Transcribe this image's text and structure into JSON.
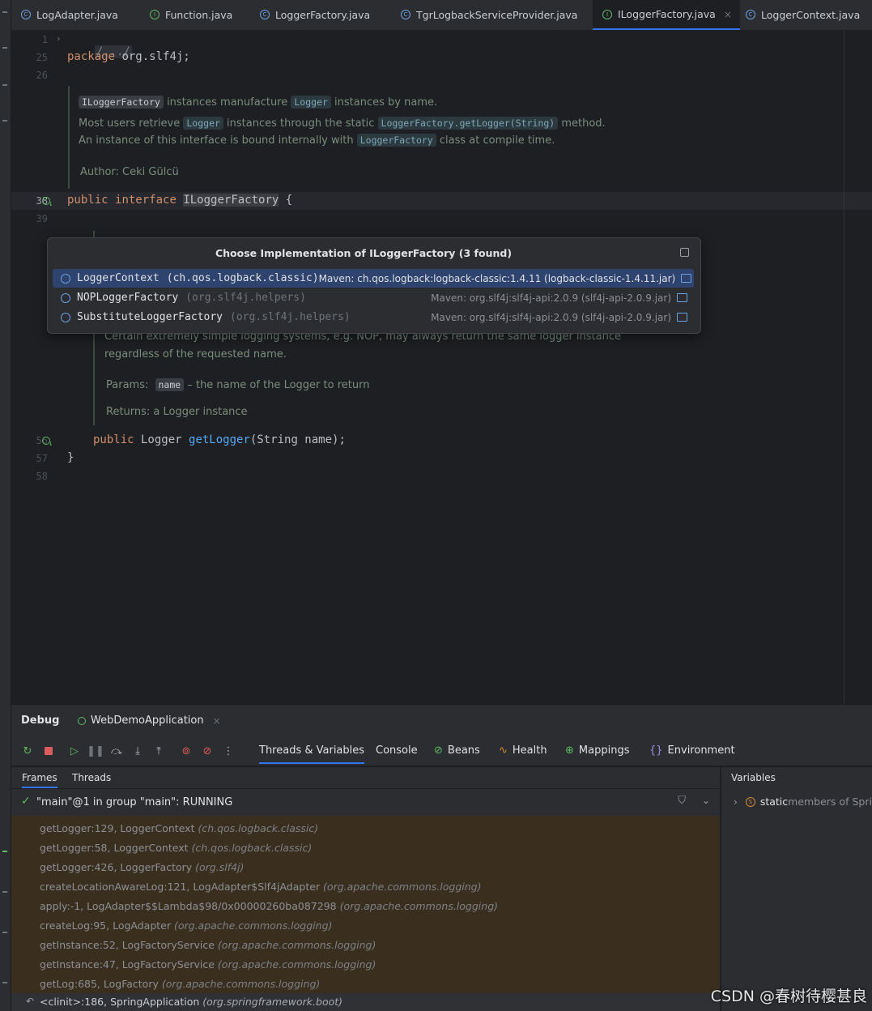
{
  "tabs": [
    {
      "label": "LogAdapter.java",
      "icon": "class-icon",
      "active": false
    },
    {
      "label": "Function.java",
      "icon": "interface-icon",
      "active": false
    },
    {
      "label": "LoggerFactory.java",
      "icon": "class-icon",
      "active": false
    },
    {
      "label": "TgrLogbackServiceProvider.java",
      "icon": "class-icon",
      "active": false
    },
    {
      "label": "ILoggerFactory.java",
      "icon": "interface-icon",
      "active": true
    },
    {
      "label": "LoggerContext.java",
      "icon": "class-icon",
      "active": false
    }
  ],
  "close_glyph": "×",
  "editor": {
    "line_numbers": [
      "1",
      "25",
      "26",
      "38",
      "39",
      "56",
      "57",
      "58"
    ],
    "fold_text": "/.../",
    "package_kw": "package",
    "package_name": " org.slf4j;",
    "doc1": {
      "chip1": "ILoggerFactory",
      "t1": " instances manufacture ",
      "chip2": "Logger",
      "t2": " instances by name.",
      "line2_a": "Most users retrieve ",
      "chip3": "Logger",
      "line2_b": " instances through the static ",
      "chip4": "LoggerFactory.getLogger(String)",
      "line2_c": " method.",
      "line3_a": "An instance of this interface is bound internally with ",
      "chip5": "LoggerFactory",
      "line3_b": " class at compile time.",
      "author": "Author: Ceki Gülcü"
    },
    "iface_kw1": "public",
    "iface_kw2": "interface",
    "iface_name": "ILoggerFactory",
    "iface_brace": " {",
    "doc2": {
      "line1": "Certain extremely simple logging systems, e.g. NOP, may always return the same logger instance",
      "line2": "regardless of the requested name.",
      "params_label": "Params:",
      "params_chip": "name",
      "params_text": " – the name of the Logger to return",
      "returns": "Returns: a Logger instance"
    },
    "method_kw": "public",
    "method_type": " Logger ",
    "method_name": "getLogger",
    "method_args": "(String name);",
    "close_brace": "}"
  },
  "popup": {
    "title": "Choose Implementation of ILoggerFactory (3 found)",
    "items": [
      {
        "name": "LoggerContext",
        "pkg": "(ch.qos.logback.classic)",
        "maven": "Maven: ch.qos.logback:logback-classic:1.4.11 (logback-classic-1.4.11.jar)",
        "selected": true
      },
      {
        "name": "NOPLoggerFactory",
        "pkg": "(org.slf4j.helpers)",
        "maven": "Maven: org.slf4j:slf4j-api:2.0.9 (slf4j-api-2.0.9.jar)",
        "selected": false
      },
      {
        "name": "SubstituteLoggerFactory",
        "pkg": "(org.slf4j.helpers)",
        "maven": "Maven: org.slf4j:slf4j-api:2.0.9 (slf4j-api-2.0.9.jar)",
        "selected": false
      }
    ]
  },
  "debug": {
    "title": "Debug",
    "session": "WebDemoApplication",
    "tabs": [
      {
        "label": "Threads & Variables",
        "icon": "",
        "active": true
      },
      {
        "label": "Console",
        "icon": "",
        "active": false
      },
      {
        "label": "Beans",
        "icon": "beans-icon",
        "active": false
      },
      {
        "label": "Health",
        "icon": "health-icon",
        "active": false
      },
      {
        "label": "Mappings",
        "icon": "mappings-icon",
        "active": false
      },
      {
        "label": "Environment",
        "icon": "environment-icon",
        "active": false
      }
    ],
    "subtabs": [
      "Frames",
      "Threads"
    ],
    "thread": "\"main\"@1 in group \"main\": RUNNING",
    "frames": [
      {
        "method": "getLogger:129, LoggerContext ",
        "pkg": "(ch.qos.logback.classic)"
      },
      {
        "method": "getLogger:58, LoggerContext ",
        "pkg": "(ch.qos.logback.classic)"
      },
      {
        "method": "getLogger:426, LoggerFactory ",
        "pkg": "(org.slf4j)"
      },
      {
        "method": "createLocationAwareLog:121, LogAdapter$Slf4jAdapter ",
        "pkg": "(org.apache.commons.logging)"
      },
      {
        "method": "apply:-1, LogAdapter$$Lambda$98/0x00000260ba087298 ",
        "pkg": "(org.apache.commons.logging)"
      },
      {
        "method": "createLog:95, LogAdapter ",
        "pkg": "(org.apache.commons.logging)"
      },
      {
        "method": "getInstance:52, LogFactoryService ",
        "pkg": "(org.apache.commons.logging)"
      },
      {
        "method": "getInstance:47, LogFactoryService ",
        "pkg": "(org.apache.commons.logging)"
      },
      {
        "method": "getLog:685, LogFactory ",
        "pkg": "(org.apache.commons.logging)"
      },
      {
        "method": "<clinit>:186, SpringApplication ",
        "pkg": "(org.springframework.boot)"
      }
    ],
    "variables_title": "Variables",
    "variable": {
      "name": "static",
      "rest": " members of Spri"
    }
  },
  "watermark": "CSDN @春树待樱甚良",
  "colors": {
    "accent": "#3574f0",
    "keyword": "#cf8e6d",
    "method": "#56a8f5",
    "frames_bg": "#3a2f1f"
  }
}
